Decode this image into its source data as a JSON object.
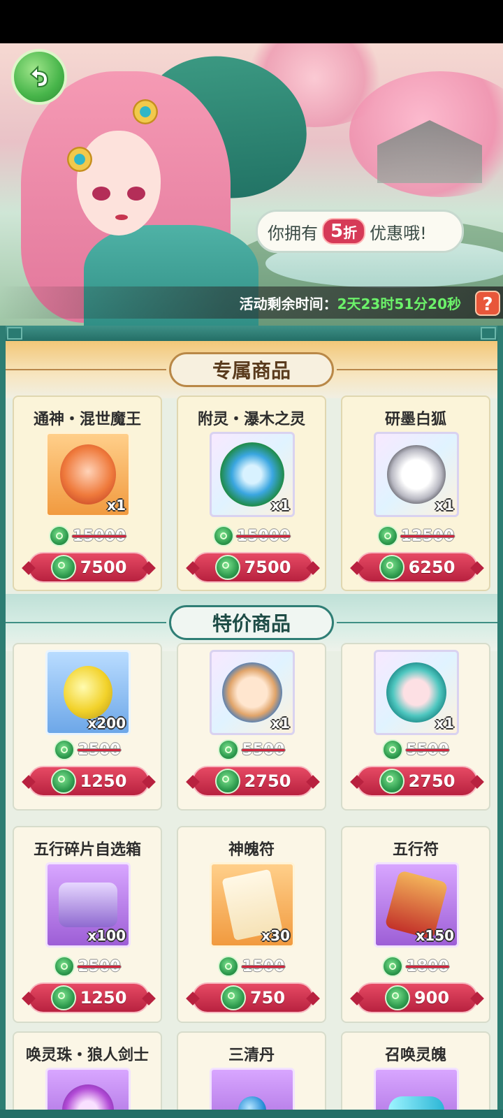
{
  "banner": {
    "bubble_prefix": "你拥有",
    "discount_number": "5",
    "discount_unit": "折",
    "bubble_suffix": "优惠哦!",
    "timer_label": "活动剩余时间：",
    "timer_value": "2天23时51分20秒",
    "help_label": "?"
  },
  "sections": {
    "exclusive_title": "专属商品",
    "special_title": "特价商品"
  },
  "exclusive_items": [
    {
      "name": "通神・混世魔王",
      "qty": "x1",
      "orig_price": "15000",
      "price": "7500"
    },
    {
      "name": "附灵・瀑木之灵",
      "qty": "x1",
      "orig_price": "15000",
      "price": "7500"
    },
    {
      "name": "研墨白狐",
      "qty": "x1",
      "orig_price": "12500",
      "price": "6250"
    }
  ],
  "special_items": [
    {
      "name": "",
      "qty": "x200",
      "orig_price": "2500",
      "price": "1250"
    },
    {
      "name": "",
      "qty": "x1",
      "orig_price": "5500",
      "price": "2750"
    },
    {
      "name": "",
      "qty": "x1",
      "orig_price": "5500",
      "price": "2750"
    },
    {
      "name": "五行碎片自选箱",
      "qty": "x100",
      "orig_price": "2500",
      "price": "1250"
    },
    {
      "name": "神魄符",
      "qty": "x30",
      "orig_price": "1500",
      "price": "750"
    },
    {
      "name": "五行符",
      "qty": "x150",
      "orig_price": "1800",
      "price": "900"
    },
    {
      "name": "唤灵珠・狼人剑士",
      "qty": "",
      "orig_price": "",
      "price": ""
    },
    {
      "name": "三清丹",
      "qty": "",
      "orig_price": "",
      "price": ""
    },
    {
      "name": "召唤灵魄",
      "qty": "",
      "orig_price": "",
      "price": ""
    }
  ],
  "colors": {
    "accent_green": "#6cf26a",
    "price_red": "#d0243c",
    "frame_teal": "#246e66"
  },
  "icons": {
    "back": "back-arrow-icon",
    "currency": "jade-coin-icon",
    "help": "question-mark-icon"
  }
}
